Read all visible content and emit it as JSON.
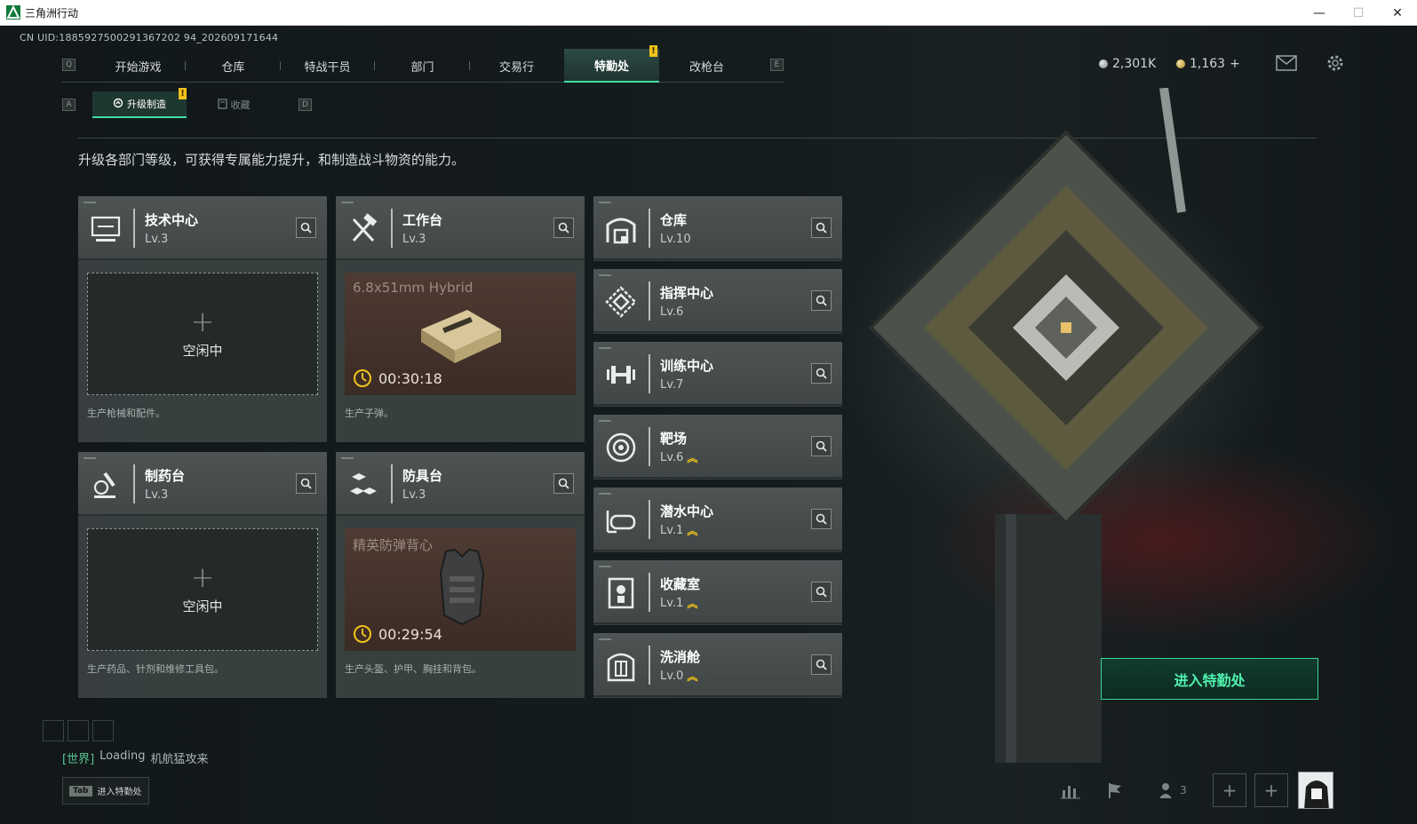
{
  "window": {
    "title": "三角洲行动",
    "minimize": "—",
    "maximize": "☐",
    "close": "✕"
  },
  "uid_text": "CN UID:1885927500291367202 94_202609171644",
  "top_nav": {
    "left_key": "Q",
    "right_key": "E",
    "tabs": [
      {
        "label": "开始游戏"
      },
      {
        "label": "仓库"
      },
      {
        "label": "特战干员"
      },
      {
        "label": "部门"
      },
      {
        "label": "交易行"
      },
      {
        "label": "特勤处",
        "active": true,
        "badge": "!"
      },
      {
        "label": "改枪台"
      }
    ]
  },
  "currency": {
    "silver": "2,301K",
    "gold": "1,163",
    "gold_add": "+"
  },
  "sub_nav": {
    "left_key": "A",
    "right_key": "D",
    "tabs": [
      {
        "label": "升级制造",
        "active": true,
        "badge": "!",
        "icon": "upgrade-icon"
      },
      {
        "label": "收藏",
        "icon": "collection-icon"
      }
    ]
  },
  "description": "升级各部门等级，可获得专属能力提升，和制造战斗物资的能力。",
  "production_cards": [
    {
      "name": "技术中心",
      "level": "Lv.3",
      "icon": "tech-center-icon",
      "status": "空闲中",
      "plus": "+",
      "footer": "生产枪械和配件。"
    },
    {
      "name": "工作台",
      "level": "Lv.3",
      "icon": "workbench-icon",
      "item": "6.8x51mm Hybrid",
      "timer": "00:30:18",
      "footer": "生产子弹。"
    },
    {
      "name": "制药台",
      "level": "Lv.3",
      "icon": "pharmacy-icon",
      "status": "空闲中",
      "plus": "+",
      "footer": "生产药品、针剂和维修工具包。"
    },
    {
      "name": "防具台",
      "level": "Lv.3",
      "icon": "armor-bench-icon",
      "item": "精英防弹背心",
      "timer": "00:29:54",
      "footer": "生产头盔、护甲、胸挂和背包。"
    }
  ],
  "facilities": [
    {
      "name": "仓库",
      "level": "Lv.10",
      "icon": "warehouse-icon"
    },
    {
      "name": "指挥中心",
      "level": "Lv.6",
      "icon": "command-center-icon"
    },
    {
      "name": "训练中心",
      "level": "Lv.7",
      "icon": "training-center-icon"
    },
    {
      "name": "靶场",
      "level": "Lv.6",
      "icon": "shooting-range-icon",
      "upgrade": "︽"
    },
    {
      "name": "潜水中心",
      "level": "Lv.1",
      "icon": "diving-center-icon",
      "upgrade": "︽"
    },
    {
      "name": "收藏室",
      "level": "Lv.1",
      "icon": "collection-room-icon",
      "upgrade": "︽"
    },
    {
      "name": "洗消舱",
      "level": "Lv.0",
      "icon": "decon-chamber-icon",
      "upgrade": "︽"
    }
  ],
  "enter_button": "进入特勤处",
  "chat": {
    "channel": "[世界]",
    "user": "Loading",
    "message": "机航猛攻来"
  },
  "tab_hint": {
    "key": "Tab",
    "label": "进入特勤处"
  },
  "bottom_bar": {
    "friends_count": "3",
    "add": "+"
  },
  "colors": {
    "accent": "#3fe0a2",
    "badge": "#f2c21b",
    "card_bg": "#4a5050",
    "busy_slot": "#4e3b32"
  }
}
